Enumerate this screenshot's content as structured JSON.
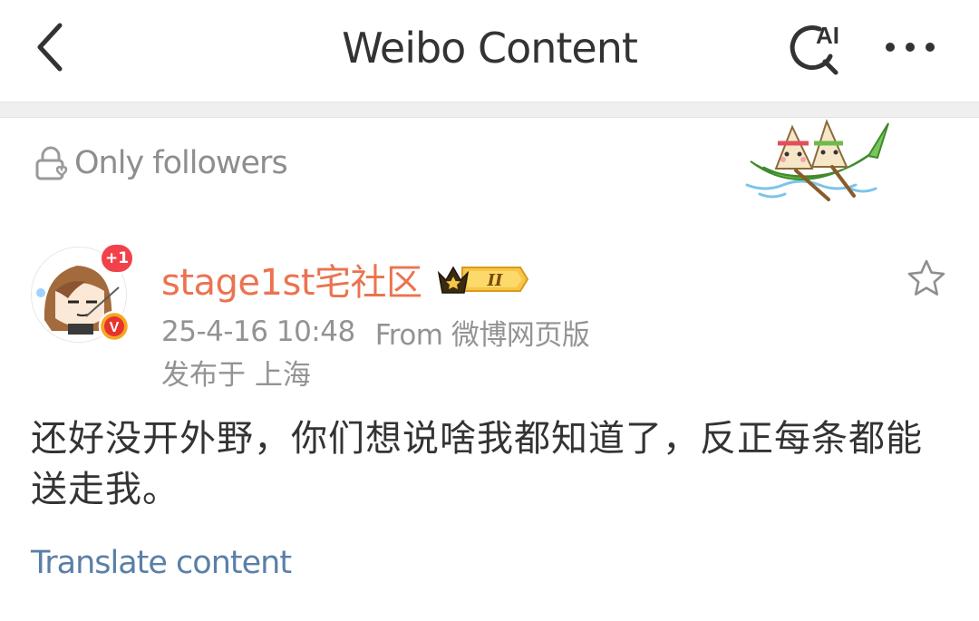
{
  "header": {
    "title": "Weibo Content",
    "ai_label": "AI",
    "icons": {
      "back": "chevron-left-icon",
      "ai_search": "ai-search-icon",
      "more": "more-dots-icon"
    }
  },
  "post": {
    "visibility": {
      "label": "Only followers",
      "icon": "lock-heart-icon"
    },
    "author": {
      "name": "stage1st宅社区",
      "avatar_badge": "+1",
      "verified_mark": "V",
      "vip_level": "II"
    },
    "meta": {
      "time": "25-4-16 10:48",
      "source": "From 微博网页版",
      "location": "发布于 上海"
    },
    "text": "还好没开外野，你们想说啥我都知道了，反正每条都能送走我。",
    "translate_label": "Translate content"
  },
  "colors": {
    "author_name": "#eb7350",
    "meta": "#939393",
    "translate_link": "#5a7fa8",
    "badge": "#f2414a",
    "separator": "#efefef"
  }
}
